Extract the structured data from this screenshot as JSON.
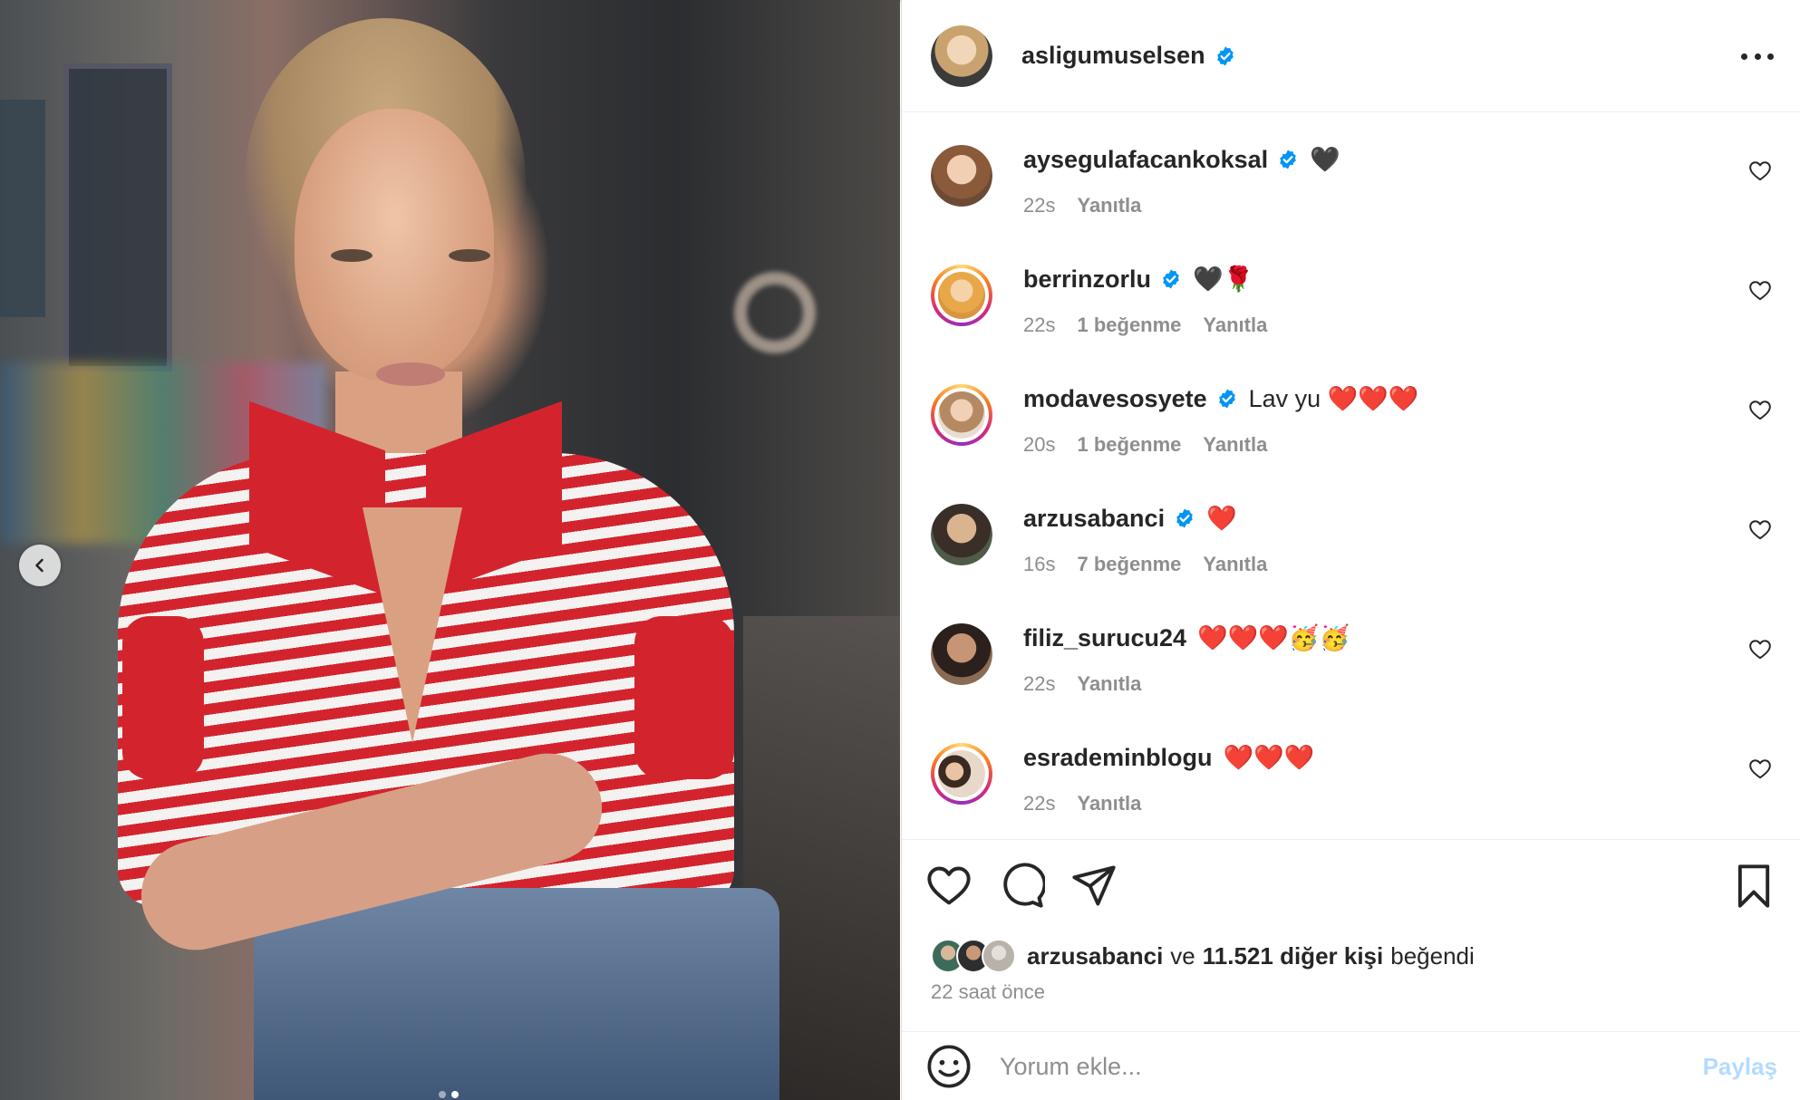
{
  "post": {
    "author": "asligumuselsen",
    "author_verified": true,
    "carousel": {
      "slide_count": 2,
      "current_slide": 2
    }
  },
  "icons": {
    "verified": "verified-badge-icon",
    "more": "more-options-icon",
    "like": "heart-outline-icon",
    "comment": "speech-bubble-icon",
    "share": "paper-plane-icon",
    "save": "bookmark-icon",
    "emoji": "smiley-icon",
    "prev": "chevron-left-icon"
  },
  "colors": {
    "verified_blue": "#0095f6",
    "muted_text": "#8e8e8e",
    "post_button_disabled": "#b3dbff",
    "heart_red": "#ed2e3e"
  },
  "comments": [
    {
      "username": "aysegulafacankoksal",
      "verified": true,
      "text": "🖤",
      "time": "22s",
      "likes": "",
      "reply": "Yanıtla",
      "story_ring": false
    },
    {
      "username": "berrinzorlu",
      "verified": true,
      "text": "🖤🌹",
      "time": "22s",
      "likes": "1 beğenme",
      "reply": "Yanıtla",
      "story_ring": true
    },
    {
      "username": "modavesosyete",
      "verified": true,
      "text": "Lav yu ❤️❤️❤️",
      "time": "20s",
      "likes": "1 beğenme",
      "reply": "Yanıtla",
      "story_ring": true
    },
    {
      "username": "arzusabanci",
      "verified": true,
      "text": "❤️",
      "time": "16s",
      "likes": "7 beğenme",
      "reply": "Yanıtla",
      "story_ring": false
    },
    {
      "username": "filiz_surucu24",
      "verified": false,
      "text": "❤️❤️❤️🥳🥳",
      "time": "22s",
      "likes": "",
      "reply": "Yanıtla",
      "story_ring": false
    },
    {
      "username": "esrademinblogu",
      "verified": false,
      "text": "❤️❤️❤️",
      "time": "22s",
      "likes": "",
      "reply": "Yanıtla",
      "story_ring": true
    }
  ],
  "likes_summary": {
    "first_liker": "arzusabanci",
    "connector": "ve",
    "others": "11.521 diğer kişi",
    "suffix": "beğendi"
  },
  "timestamp": "22 saat önce",
  "composer": {
    "placeholder": "Yorum ekle...",
    "post_label": "Paylaş"
  }
}
